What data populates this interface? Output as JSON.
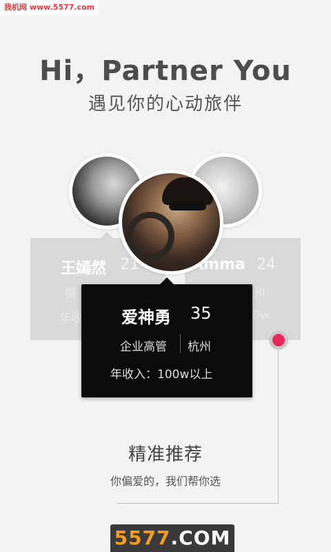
{
  "watermark_top": "我机网 www.5577.com",
  "hero": {
    "title": "Hi，Partner You",
    "subtitle": "遇见你的心动旅伴"
  },
  "cards": {
    "left": {
      "name": "王嫣然",
      "age": "21",
      "line1": "摄",
      "line2": "年收"
    },
    "right": {
      "name": "Amma",
      "age": "24",
      "line1": "州",
      "line2": "0w"
    },
    "featured": {
      "name": "爱神勇",
      "age": "35",
      "job": "企业高管",
      "city": "杭州",
      "income": "年收入：100w以上"
    }
  },
  "feature": {
    "title": "精准推荐",
    "description": "你偏爱的，我们帮你选"
  },
  "watermark_bottom": {
    "num": "5577",
    "com": ".COM"
  },
  "colors": {
    "accent": "#e8285a",
    "card_back": "#d9d9d9",
    "card_front": "#0b0b0b",
    "background": "#f3f3f3"
  }
}
